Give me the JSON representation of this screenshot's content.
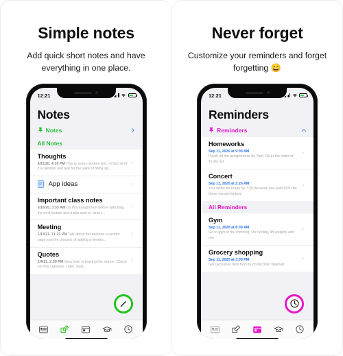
{
  "colors": {
    "green": "#23c31f",
    "green_text": "#2bbf3a",
    "pink": "#e218c8",
    "blue": "#2a72e8",
    "chevron_blue": "#3b8bf0",
    "screen_bg": "#f2f2f6"
  },
  "panels": [
    {
      "id": "notes",
      "headline": "Simple notes",
      "subline": "Add quick short notes and have everything in one place.",
      "status": {
        "time": "12:21",
        "signal_icon": "cellular-bars-icon",
        "wifi_icon": "wifi-icon",
        "battery_icon": "battery-icon"
      },
      "screen_title": "Notes",
      "pinned": {
        "label": "Notes",
        "pin_icon": "pin-icon",
        "chevron_icon": "chevron-right-icon"
      },
      "section_header": "All Notes",
      "rows": [
        {
          "title": "Thoughts",
          "date": "9/11/20, 4:39 PM",
          "preview": "This is some random text. In fact all of it is random and just for the sake of filling sp...",
          "date_style": "grey",
          "icon": null
        },
        {
          "title": "App ideas",
          "date": "",
          "preview": "",
          "date_style": "grey",
          "icon": "document-icon"
        },
        {
          "title": "Important class notes",
          "date": "9/16/20, 3:33 AM",
          "preview": "Do this assignment before watching the next lecture and make sure to have t...",
          "date_style": "grey",
          "icon": null
        },
        {
          "title": "Meeting",
          "date": "1/13/21, 11:23 PM",
          "preview": "Talk about the become a vendor page and the process of adding a vendor...",
          "date_style": "grey",
          "icon": null
        },
        {
          "title": "Quotes",
          "date": "2/4/21, 2:39 PM",
          "preview": "Sexy train is leaving the station. Check out this caboose. Later, sluts...",
          "date_style": "grey",
          "icon": null
        }
      ],
      "fab": {
        "icon": "pencil-icon",
        "color": "green"
      },
      "tabs": [
        {
          "name": "list-tab",
          "icon": "list-icon",
          "active": false
        },
        {
          "name": "compose-tab",
          "icon": "compose-icon",
          "active": true
        },
        {
          "name": "calendar-tab",
          "icon": "calendar-icon",
          "active": false
        },
        {
          "name": "graduation-tab",
          "icon": "graduation-cap-icon",
          "active": false
        },
        {
          "name": "clock-tab",
          "icon": "clock-icon",
          "active": false
        }
      ]
    },
    {
      "id": "reminders",
      "headline": "Never forget",
      "subline": "Customize your reminders and forget forgetting 😄",
      "status": {
        "time": "12:21",
        "signal_icon": "cellular-bars-icon",
        "wifi_icon": "wifi-icon",
        "battery_icon": "battery-icon"
      },
      "screen_title": "Reminders",
      "pinned": {
        "label": "Reminders",
        "pin_icon": "pin-icon",
        "chevron_icon": "chevron-up-icon"
      },
      "section_header": "All Reminders",
      "pinned_rows": [
        {
          "title": "Homeworks",
          "date": "Sep 11, 2020 at 9:00 AM",
          "preview": "Finish all the assignments by 7pm. Do in the order of To-Do list",
          "date_style": "blue"
        },
        {
          "title": "Concert",
          "date": "Sep 11, 2020 at 2:26 AM",
          "preview": "You better be ready by 7:30 because you paid $150 for these concert tickets",
          "date_style": "blue"
        }
      ],
      "rows": [
        {
          "title": "Gym",
          "date": "Sep 11, 2020 at 8:00 AM",
          "preview": "Go to gym in the morning. Do cycling, lift weights and run",
          "date_style": "blue",
          "icon": null
        },
        {
          "title": "Grocery shopping",
          "date": "Sep 11, 2020 at 3:00 PM",
          "preview": "Get Groceries item from to do list from Walmart",
          "date_style": "blue",
          "icon": null
        }
      ],
      "fab": {
        "icon": "clock-icon",
        "color": "pink"
      },
      "tabs": [
        {
          "name": "list-tab",
          "icon": "list-icon",
          "active": false
        },
        {
          "name": "compose-tab",
          "icon": "compose-icon",
          "active": false
        },
        {
          "name": "calendar-tab",
          "icon": "calendar-icon",
          "active": true
        },
        {
          "name": "graduation-tab",
          "icon": "graduation-cap-icon",
          "active": false
        },
        {
          "name": "clock-tab",
          "icon": "clock-icon",
          "active": false
        }
      ]
    }
  ]
}
